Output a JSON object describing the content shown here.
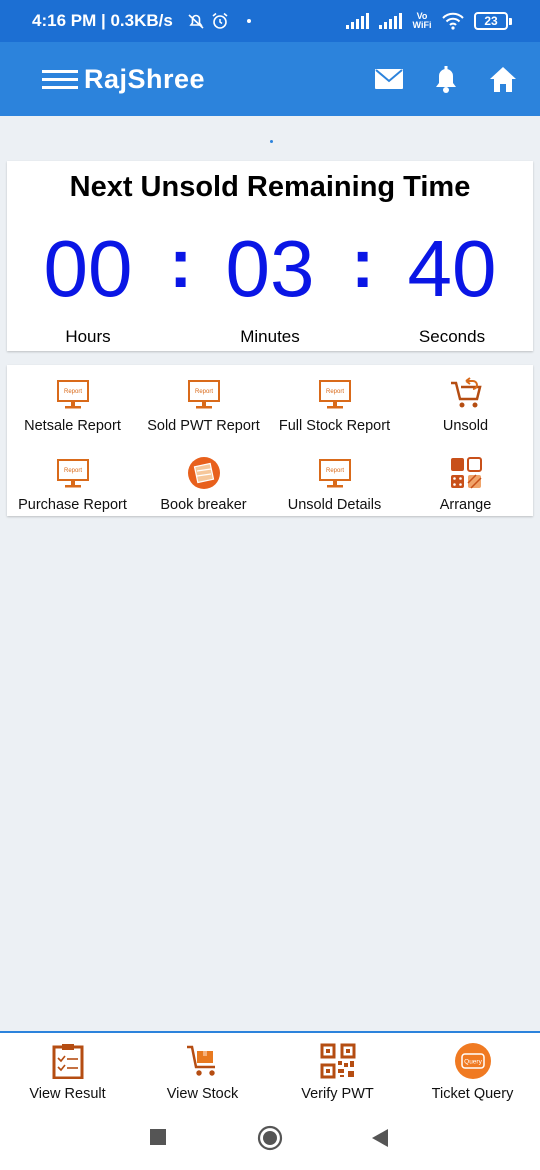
{
  "status_bar": {
    "time_speed": "4:16 PM | 0.3KB/s",
    "network_label": "Vo WiFi",
    "battery": "23"
  },
  "app_bar": {
    "brand": "RajShree",
    "icons": [
      "menu-icon",
      "mail-icon",
      "bell-icon",
      "home-icon"
    ]
  },
  "countdown": {
    "title": "Next Unsold Remaining Time",
    "hours": "00",
    "minutes": "03",
    "seconds": "40",
    "hours_label": "Hours",
    "minutes_label": "Minutes",
    "seconds_label": "Seconds",
    "digit_color": "#0a16e5"
  },
  "menu_grid": [
    {
      "label": "Netsale Report",
      "icon": "report-monitor-icon"
    },
    {
      "label": "Sold PWT Report",
      "icon": "report-monitor-icon"
    },
    {
      "label": "Full Stock Report",
      "icon": "report-monitor-icon"
    },
    {
      "label": "Unsold",
      "icon": "cart-return-icon"
    },
    {
      "label": "Purchase Report",
      "icon": "report-monitor-icon"
    },
    {
      "label": "Book breaker",
      "icon": "book-breaker-icon"
    },
    {
      "label": "Unsold Details",
      "icon": "report-monitor-icon"
    },
    {
      "label": "Arrange",
      "icon": "arrange-tiles-icon"
    }
  ],
  "report_icon_text": "Report",
  "bottom_nav": [
    {
      "label": "View Result",
      "icon": "clipboard-check-icon"
    },
    {
      "label": "View Stock",
      "icon": "cart-box-icon"
    },
    {
      "label": "Verify PWT",
      "icon": "qr-code-icon"
    },
    {
      "label": "Ticket Query",
      "icon": "query-ticket-icon"
    }
  ],
  "query_icon_text": "Query",
  "colors": {
    "status_bar": "#1c6fd3",
    "app_bar": "#2c83dc",
    "accent_orange": "#d96a1a",
    "background": "#ecf0f4"
  }
}
